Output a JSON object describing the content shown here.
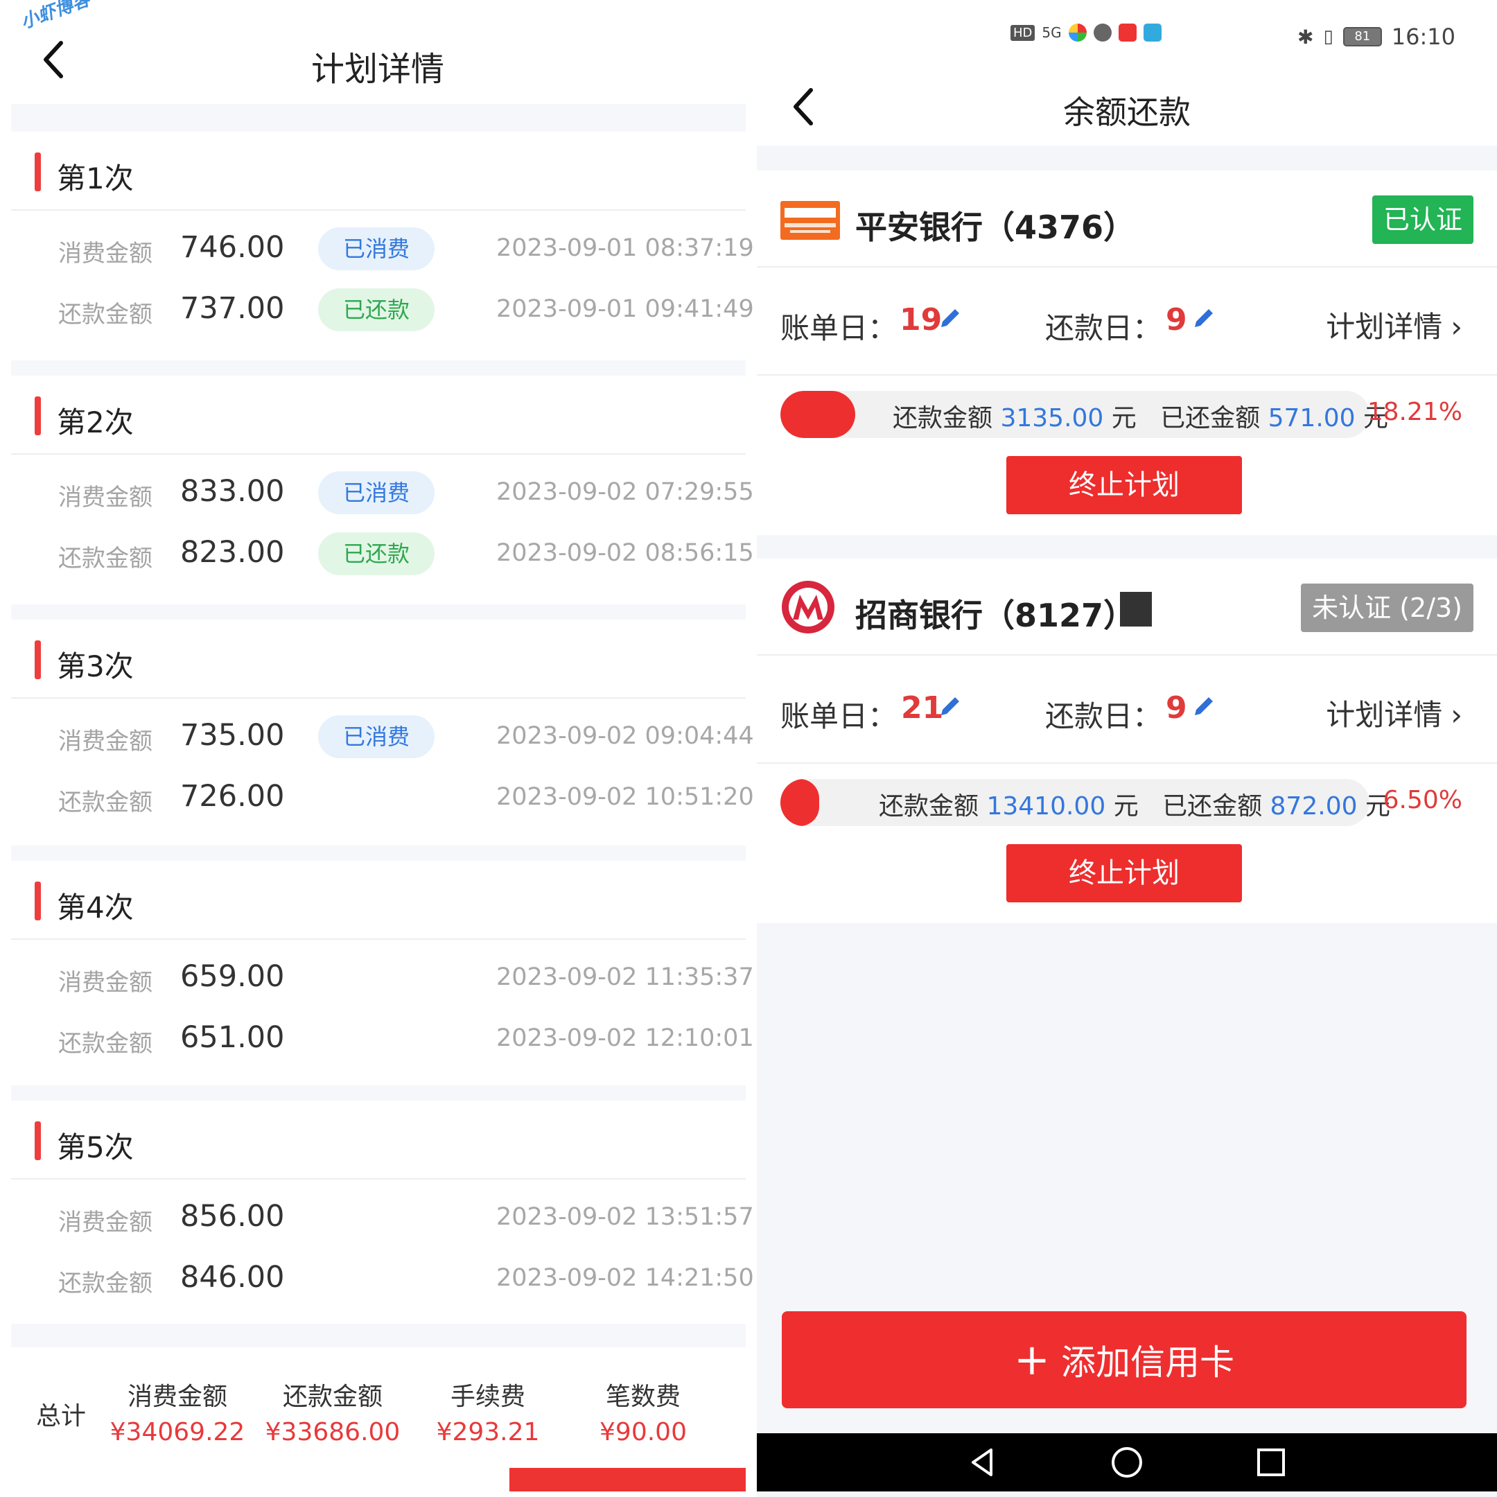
{
  "watermark": "小虾博客",
  "left": {
    "title": "计划详情",
    "sections": [
      {
        "title": "第1次",
        "spend": {
          "label": "消费金额",
          "value": "746.00",
          "badge": "已消费",
          "time": "2023-09-01 08:37:19"
        },
        "repay": {
          "label": "还款金额",
          "value": "737.00",
          "badge": "已还款",
          "time": "2023-09-01 09:41:49"
        }
      },
      {
        "title": "第2次",
        "spend": {
          "label": "消费金额",
          "value": "833.00",
          "badge": "已消费",
          "time": "2023-09-02 07:29:55"
        },
        "repay": {
          "label": "还款金额",
          "value": "823.00",
          "badge": "已还款",
          "time": "2023-09-02 08:56:15"
        }
      },
      {
        "title": "第3次",
        "spend": {
          "label": "消费金额",
          "value": "735.00",
          "badge": "已消费",
          "time": "2023-09-02 09:04:44"
        },
        "repay": {
          "label": "还款金额",
          "value": "726.00",
          "badge": "",
          "time": "2023-09-02 10:51:20"
        }
      },
      {
        "title": "第4次",
        "spend": {
          "label": "消费金额",
          "value": "659.00",
          "badge": "",
          "time": "2023-09-02 11:35:37"
        },
        "repay": {
          "label": "还款金额",
          "value": "651.00",
          "badge": "",
          "time": "2023-09-02 12:10:01"
        }
      },
      {
        "title": "第5次",
        "spend": {
          "label": "消费金额",
          "value": "856.00",
          "badge": "",
          "time": "2023-09-02 13:51:57"
        },
        "repay": {
          "label": "还款金额",
          "value": "846.00",
          "badge": "",
          "time": "2023-09-02 14:21:50"
        }
      }
    ],
    "total": {
      "label": "总计",
      "cols": [
        {
          "head": "消费金额",
          "value": "¥34069.22"
        },
        {
          "head": "还款金额",
          "value": "¥33686.00"
        },
        {
          "head": "手续费",
          "value": "¥293.21"
        },
        {
          "head": "笔数费",
          "value": "¥90.00"
        }
      ]
    }
  },
  "right": {
    "status": {
      "time": "16:10",
      "battery": "81",
      "network": "5G",
      "hd": "HD"
    },
    "title": "余额还款",
    "cards": [
      {
        "bank": "平安银行（4376）",
        "cert": "已认证",
        "bill_label": "账单日：",
        "bill_day": "19",
        "repay_label": "还款日：",
        "repay_day": "9",
        "plan_link": "计划详情",
        "progress_fraction": 0.1821,
        "amount_label": "还款金额",
        "amount": "3135.00",
        "unit": "元",
        "paid_label": "已还金额",
        "paid": "571.00",
        "percent": "18.21%",
        "stop": "终止计划"
      },
      {
        "bank": "招商银行（8127）",
        "cert": "未认证 (2/3)",
        "bill_label": "账单日：",
        "bill_day": "21",
        "repay_label": "还款日：",
        "repay_day": "9",
        "plan_link": "计划详情",
        "progress_fraction": 0.065,
        "amount_label": "还款金额",
        "amount": "13410.00",
        "unit": "元",
        "paid_label": "已还金额",
        "paid": "872.00",
        "percent": "6.50%",
        "stop": "终止计划"
      }
    ],
    "add_card": "添加信用卡",
    "colors": {
      "accent_red": "#ee2d2d",
      "link_blue": "#3377dd",
      "cert_green": "#22b455"
    }
  }
}
